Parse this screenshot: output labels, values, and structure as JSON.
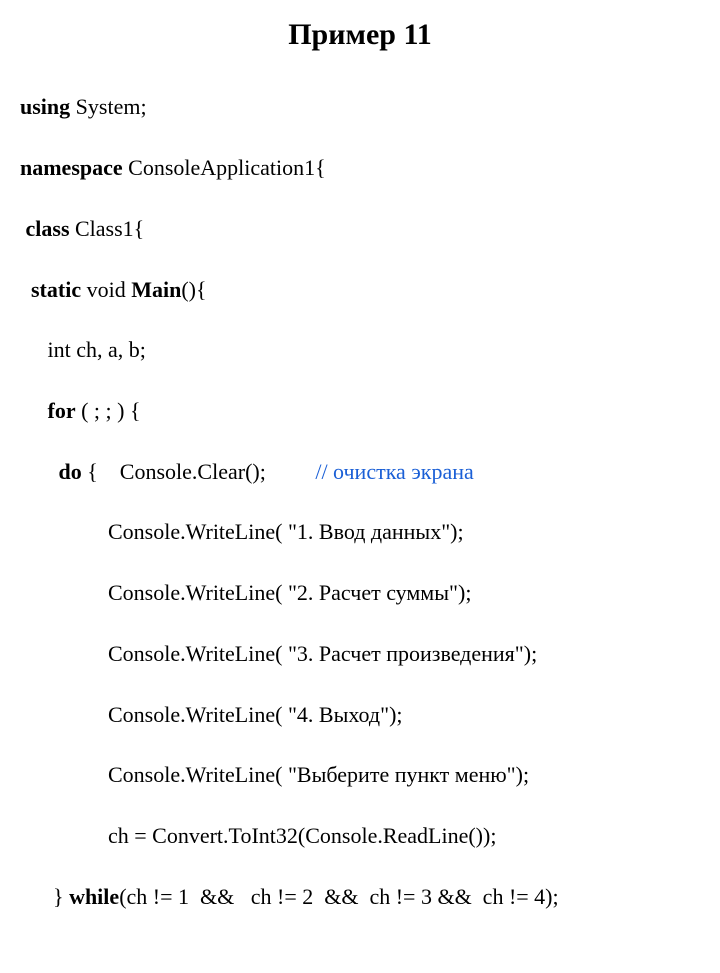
{
  "title": "Пример 11",
  "code": {
    "l1": {
      "kw": "using",
      "rest": " System;"
    },
    "l2": {
      "kw": "namespace",
      "rest": " ConsoleApplication1{"
    },
    "l3": {
      "pre": " ",
      "kw": "class",
      "rest": " Class1{"
    },
    "l4": {
      "pre": "  ",
      "kw1": "static",
      "mid": " void ",
      "kw2": "Main",
      "rest": "(){"
    },
    "l5": {
      "pre": "     ",
      "text": "int ch, a, b;"
    },
    "l6": {
      "pre": "     ",
      "kw": "for",
      "rest": " ( ; ; ) {"
    },
    "l7": {
      "pre": "       ",
      "kw": "do",
      "mid": " {    Console.Clear();         ",
      "comment": "// очистка экрана"
    },
    "l8": {
      "pre": "                ",
      "text": "Console.WriteLine( \"1. Ввод данных\");"
    },
    "l9": {
      "pre": "                ",
      "text": "Console.WriteLine( \"2. Расчет суммы\");"
    },
    "l10": {
      "pre": "                ",
      "text": "Console.WriteLine( \"3. Расчет произведения\");"
    },
    "l11": {
      "pre": "                ",
      "text": "Console.WriteLine( \"4. Выход\");"
    },
    "l12": {
      "pre": "                ",
      "text": "Console.WriteLine( \"Выберите пункт меню\");"
    },
    "l13": {
      "pre": "                ",
      "text": "ch = Convert.ToInt32(Console.ReadLine());"
    },
    "l14": {
      "pre": "      } ",
      "kw": "while",
      "rest": "(ch != 1  &&   ch != 2  &&  ch != 3 &&  ch != 4);"
    }
  }
}
